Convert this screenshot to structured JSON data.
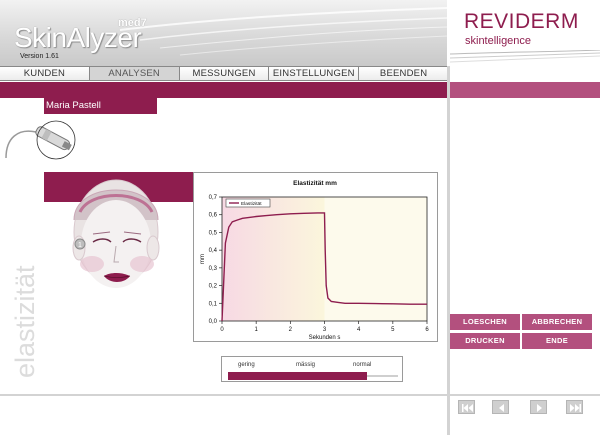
{
  "header": {
    "logo": "SkinAlyzer",
    "logo_sup": "med7",
    "version": "Version 1.61",
    "brand": "REVIDERM",
    "brand_sub": "skintelligence"
  },
  "nav": [
    {
      "label": "KUNDEN",
      "active": false
    },
    {
      "label": "ANALYSEN",
      "active": true
    },
    {
      "label": "MESSUNGEN",
      "active": false
    },
    {
      "label": "EINSTELLUNGEN",
      "active": false
    },
    {
      "label": "BEENDEN",
      "active": false
    }
  ],
  "patient": {
    "name": "Maria   Pastell"
  },
  "side_label": "elastizität",
  "face_marker": "1",
  "chart_data": {
    "type": "line",
    "title": "Elastizität  mm",
    "xlabel": "Sekunden  s",
    "ylabel": "mm",
    "xlim": [
      0,
      6
    ],
    "ylim": [
      0,
      0.7
    ],
    "xticks": [
      "0",
      "1",
      "2",
      "3",
      "4",
      "5",
      "6"
    ],
    "yticks": [
      "0,0",
      "0,1",
      "0,2",
      "0,3",
      "0,4",
      "0,5",
      "0,6",
      "0,7"
    ],
    "legend": "Elastizität",
    "series": [
      {
        "name": "Elastizität",
        "x": [
          0,
          0.1,
          0.2,
          0.3,
          0.45,
          0.6,
          0.8,
          1.0,
          1.3,
          1.6,
          2.0,
          2.4,
          2.8,
          3.0,
          3.02,
          3.05,
          3.1,
          3.2,
          3.4,
          3.6,
          4.0,
          4.5,
          5.0,
          5.5,
          6.0
        ],
        "y": [
          0.0,
          0.44,
          0.53,
          0.56,
          0.57,
          0.58,
          0.585,
          0.59,
          0.595,
          0.6,
          0.605,
          0.608,
          0.61,
          0.61,
          0.4,
          0.2,
          0.13,
          0.11,
          0.105,
          0.1,
          0.1,
          0.098,
          0.097,
          0.095,
          0.095
        ]
      }
    ],
    "shaded_region": "0 – 3 s",
    "colors": {
      "line": "#8e1d4e",
      "shade": "#fbf6dc",
      "plot_bg": "#ffffff"
    }
  },
  "scale": {
    "labels": [
      "gering",
      "mässig",
      "normal"
    ],
    "level_fraction": 0.82
  },
  "buttons": {
    "loeschen": "LOESCHEN",
    "abbrechen": "ABBRECHEN",
    "drucken": "DRUCKEN",
    "ende": "ENDE"
  },
  "icons": {
    "nav_first": "first-icon",
    "nav_prev": "previous-icon",
    "nav_next": "next-icon",
    "nav_last": "last-icon",
    "probe": "probe-icon"
  },
  "colors": {
    "accent": "#8e1d4e",
    "button": "#b3507e",
    "divider": "#d3d3d3"
  }
}
